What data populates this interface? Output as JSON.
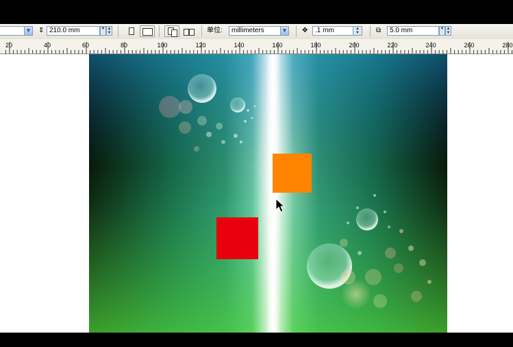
{
  "property_bar": {
    "page_height_value": "210.0 mm",
    "units_label": "单位:",
    "units_value": "millimeters",
    "nudge_value": ".1 mm",
    "duplicate_distance_value": "5.0 mm"
  },
  "ruler": {
    "units": "millimeters",
    "tick_labels": [
      "20",
      "40",
      "60",
      "80",
      "100",
      "120",
      "140",
      "160",
      "180",
      "200",
      "220",
      "240",
      "260",
      "280"
    ]
  },
  "canvas": {
    "background": "blue-green gradient with white light beam and bubbles",
    "shapes": [
      {
        "name": "orange-square",
        "color": "#ff8400"
      },
      {
        "name": "red-square",
        "color": "#e8000e"
      }
    ]
  },
  "colors": {
    "toolbar_bg": "#ece9d8",
    "field_border": "#7f9db9",
    "orange": "#ff8400",
    "red": "#e8000e"
  }
}
